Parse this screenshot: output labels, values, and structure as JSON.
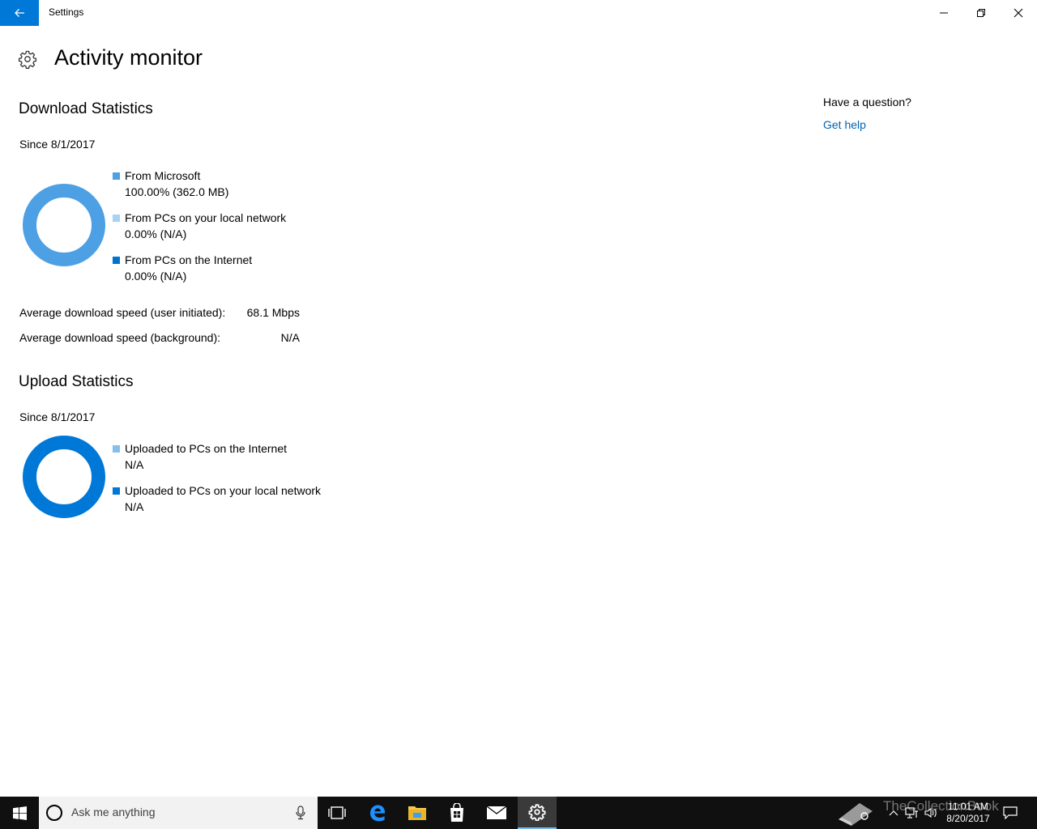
{
  "window": {
    "title": "Settings"
  },
  "page": {
    "title": "Activity monitor"
  },
  "download": {
    "heading": "Download Statistics",
    "since": "Since 8/1/2017",
    "legend": [
      {
        "label": "From Microsoft",
        "value": "100.00%  (362.0 MB)",
        "color": "#4ea0e5",
        "percent": 100
      },
      {
        "label": "From PCs on your local network",
        "value": "0.00%  (N/A)",
        "color": "#a6d2f6",
        "percent": 0
      },
      {
        "label": "From PCs on the Internet",
        "value": "0.00%  (N/A)",
        "color": "#0072d1",
        "percent": 0
      }
    ],
    "stats": [
      {
        "label": "Average download speed (user initiated):",
        "value": "68.1 Mbps"
      },
      {
        "label": "Average download speed (background):",
        "value": "N/A"
      }
    ],
    "ring_color": "#4ea0e5"
  },
  "upload": {
    "heading": "Upload Statistics",
    "since": "Since 8/1/2017",
    "legend": [
      {
        "label": "Uploaded to PCs on the Internet",
        "value": "N/A",
        "color": "#83c0ef"
      },
      {
        "label": "Uploaded to PCs on your local network",
        "value": "N/A",
        "color": "#0078d7"
      }
    ],
    "ring_color": "#0078d7"
  },
  "help": {
    "question": "Have a question?",
    "link": "Get help"
  },
  "taskbar": {
    "search_placeholder": "Ask me anything",
    "apps": [
      "task-view-icon",
      "edge-icon",
      "file-explorer-icon",
      "store-icon",
      "mail-icon",
      "settings-icon"
    ],
    "time": "11:01 AM",
    "date": "8/20/2017",
    "watermark": "TheCollectionBook"
  },
  "colors": {
    "accent": "#0078d7",
    "link": "#0063b1"
  }
}
